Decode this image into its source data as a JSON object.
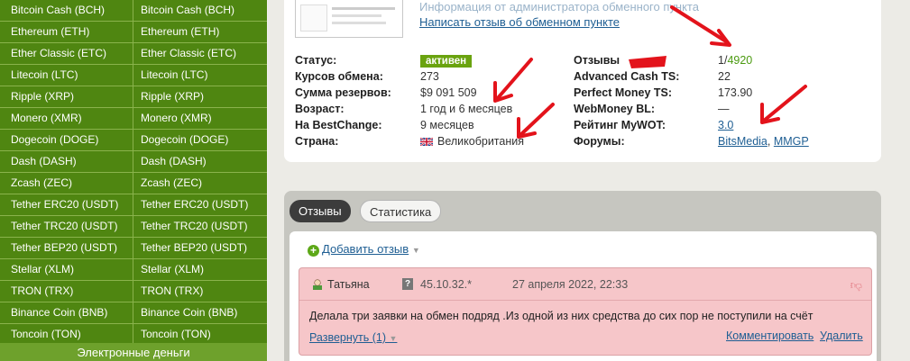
{
  "currencies": [
    [
      "Bitcoin Cash (BCH)",
      "Bitcoin Cash (BCH)"
    ],
    [
      "Ethereum (ETH)",
      "Ethereum (ETH)"
    ],
    [
      "Ether Classic (ETC)",
      "Ether Classic (ETC)"
    ],
    [
      "Litecoin (LTC)",
      "Litecoin (LTC)"
    ],
    [
      "Ripple (XRP)",
      "Ripple (XRP)"
    ],
    [
      "Monero (XMR)",
      "Monero (XMR)"
    ],
    [
      "Dogecoin (DOGE)",
      "Dogecoin (DOGE)"
    ],
    [
      "Dash (DASH)",
      "Dash (DASH)"
    ],
    [
      "Zcash (ZEC)",
      "Zcash (ZEC)"
    ],
    [
      "Tether ERC20 (USDT)",
      "Tether ERC20 (USDT)"
    ],
    [
      "Tether TRC20 (USDT)",
      "Tether TRC20 (USDT)"
    ],
    [
      "Tether BEP20 (USDT)",
      "Tether BEP20 (USDT)"
    ],
    [
      "Stellar (XLM)",
      "Stellar (XLM)"
    ],
    [
      "TRON (TRX)",
      "TRON (TRX)"
    ],
    [
      "Binance Coin (BNB)",
      "Binance Coin (BNB)"
    ],
    [
      "Toncoin (TON)",
      "Toncoin (TON)"
    ]
  ],
  "section_header": "Электронные деньги",
  "header": {
    "admin_info": "Информация от администратора обменного пункта",
    "write_review": "Написать отзыв об обменном пункте"
  },
  "stats_left": {
    "status_label": "Статус:",
    "status_value": "активен",
    "courses_label": "Курсов обмена:",
    "courses_value": "273",
    "reserves_label": "Сумма резервов:",
    "reserves_value": "$9 091 509",
    "age_label": "Возраст:",
    "age_value": "1 год и 6 месяцев",
    "bestchange_label": "На BestChange:",
    "bestchange_value": "9 месяцев",
    "country_label": "Страна:",
    "country_value": "Великобритания"
  },
  "stats_right": {
    "reviews_label": "Отзывы",
    "reviews_bad": "1",
    "reviews_sep": "/",
    "reviews_good": "4920",
    "advcash_label": "Advanced Cash TS:",
    "advcash_value": "22",
    "pm_label": "Perfect Money TS:",
    "pm_value": "173.90",
    "wm_label": "WebMoney BL:",
    "wm_value": "—",
    "mywot_label": "Рейтинг MyWOT:",
    "mywot_value": "3.0",
    "forums_label": "Форумы:",
    "forum1": "BitsMedia",
    "forum_sep": ",",
    "forum2": "MMGP"
  },
  "tabs": {
    "reviews": "Отзывы",
    "stats": "Статистика"
  },
  "add_review": "Добавить отзыв",
  "review": {
    "user": "Татьяна",
    "ip": "45.10.32.*",
    "date": "27 апреля 2022, 22:33",
    "text": "Делала три заявки на обмен подряд .Из одной из них средства до сих пор не поступили на счёт",
    "expand": "Развернуть (1)",
    "comment": "Комментировать",
    "delete": "Удалить"
  },
  "colors": {
    "sidebar_green": "#4f8611",
    "status_green": "#6aa30f",
    "review_pink": "#f6c6c9",
    "link_blue": "#1e5e93",
    "annotation_red": "#e3131b"
  },
  "icons": [
    "plus-icon",
    "user-icon",
    "question-icon",
    "thumb-down-icon",
    "flag-uk-icon",
    "caret-down-icon"
  ]
}
